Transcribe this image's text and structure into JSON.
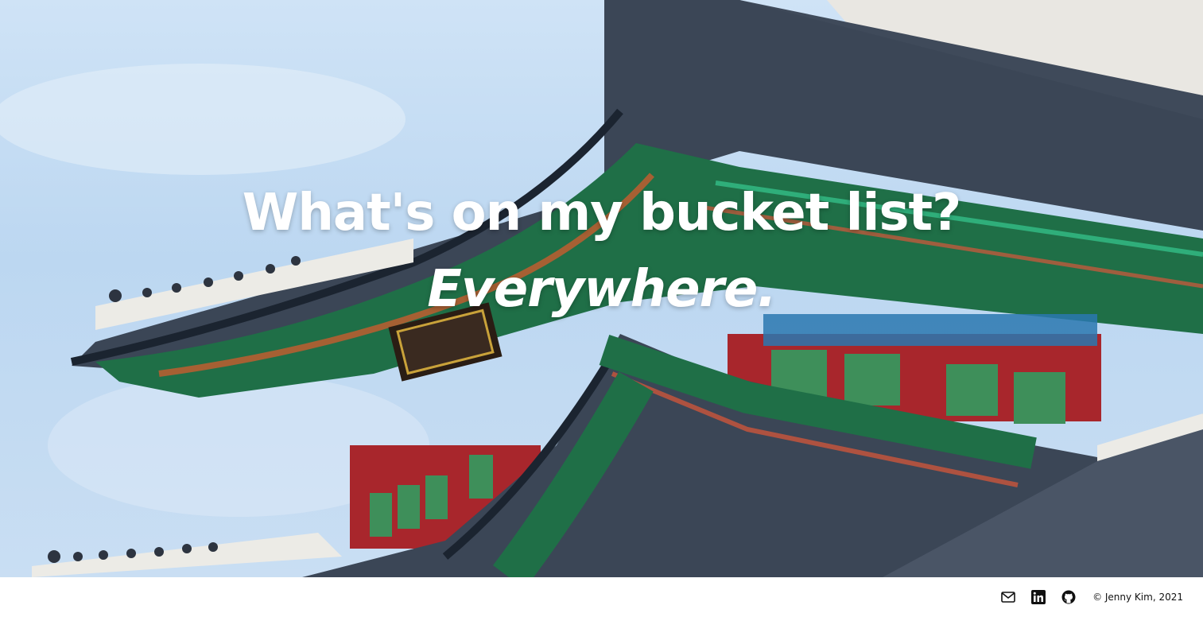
{
  "hero": {
    "headline_line1": "What's on my bucket list?",
    "headline_line2": "Everywhere.",
    "background_image": "palace-roof-photo"
  },
  "footer": {
    "icons": [
      "envelope-icon",
      "linkedin-icon",
      "github-icon"
    ],
    "copyright": "© Jenny Kim, 2021"
  },
  "colors": {
    "sky": "#c6ddf3",
    "roof_tile": "#4a5566",
    "eave_green": "#1f7a4d",
    "pillar_red": "#b3262f",
    "headline": "#ffffff"
  }
}
